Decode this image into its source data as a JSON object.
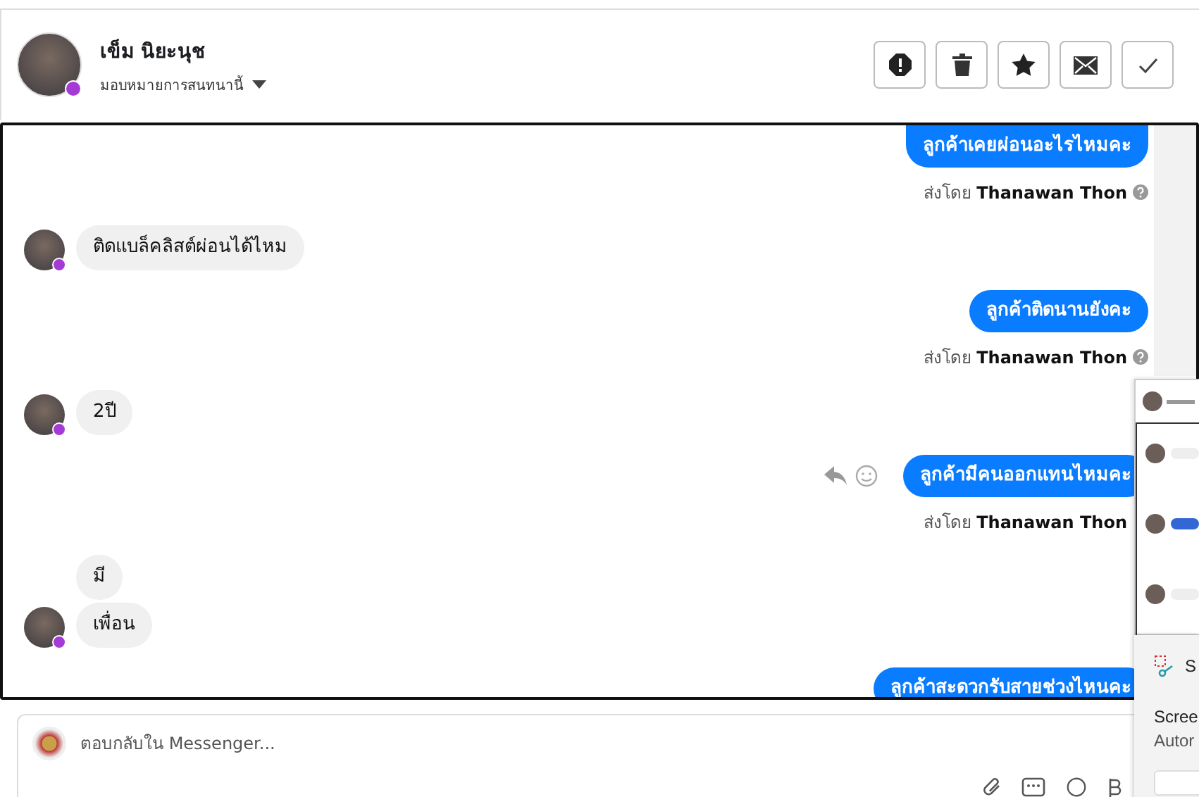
{
  "header": {
    "name": "เข็ม นิยะนุช",
    "assign_label": "มอบหมายการสนทนานี้",
    "actions": [
      {
        "kind": "alert"
      },
      {
        "kind": "trash"
      },
      {
        "kind": "star"
      },
      {
        "kind": "mail"
      },
      {
        "kind": "check"
      }
    ]
  },
  "messages": [
    {
      "kind": "outgoing",
      "text": "ลูกค้าเคยผ่อนอะไรไหมคะ",
      "sent_by": "ส่งโดย",
      "sender": "Thanawan Thon",
      "hover_actions": false,
      "help_icon_hidden": false
    },
    {
      "kind": "incoming",
      "bubbles": [
        "ติดแบล็คลิสต์ผ่อนได้ไหม"
      ]
    },
    {
      "kind": "outgoing",
      "text": "ลูกค้าติดนานยังคะ",
      "sent_by": "ส่งโดย",
      "sender": "Thanawan Thon",
      "hover_actions": false,
      "help_icon_hidden": false
    },
    {
      "kind": "incoming",
      "bubbles": [
        "2ปี"
      ]
    },
    {
      "kind": "outgoing",
      "text": "ลูกค้ามีคนออกแทนไหมคะ",
      "sent_by": "ส่งโดย",
      "sender": "Thanawan Thon",
      "hover_actions": true,
      "help_icon_hidden": true
    },
    {
      "kind": "incoming",
      "bubbles": [
        "มี",
        "เพื่อน"
      ]
    },
    {
      "kind": "outgoing",
      "text": "ลูกค้าสะดวกรับสายช่วงไหนคะ",
      "hover_actions": false
    }
  ],
  "composer": {
    "placeholder": "ตอบกลับใน Messenger..."
  },
  "snip_popup": {
    "app": "S",
    "title": "Scree",
    "subtitle": "Autor"
  }
}
